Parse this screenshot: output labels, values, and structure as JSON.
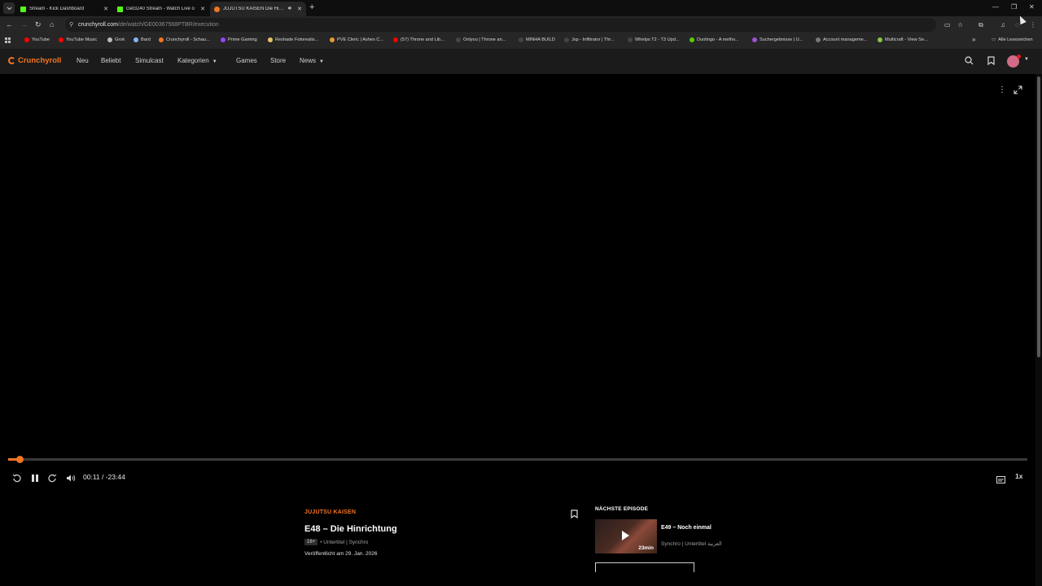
{
  "browser": {
    "tabs": [
      {
        "title": "Stream - Kick Dashboard",
        "favicon_color": "#53fc18",
        "active": false
      },
      {
        "title": "Get3240 Stream - Watch Live o",
        "favicon_color": "#53fc18",
        "active": false
      },
      {
        "title": "JUJUTSU KAISEN Die Hinrich",
        "favicon_color": "#f47521",
        "active": true
      }
    ],
    "url_host": "crunchyroll.com",
    "url_path": "/de/watch/GE00367568PTBR/execution",
    "bookmarks": [
      {
        "label": "YouTube",
        "color": "#ff0000"
      },
      {
        "label": "YouTube Music",
        "color": "#ff0000"
      },
      {
        "label": "Grok",
        "color": "#bbbbbb"
      },
      {
        "label": "Bard",
        "color": "#8ab4f8"
      },
      {
        "label": "Crunchyroll - Schau...",
        "color": "#f47521"
      },
      {
        "label": "Prime Gaming",
        "color": "#9146ff"
      },
      {
        "label": "Reshade Fotorealis...",
        "color": "#e8c26a"
      },
      {
        "label": "PVE Cleric | Ashes C...",
        "color": "#e89a3a"
      },
      {
        "label": "(57) Throne and Lib...",
        "color": "#ff0000"
      },
      {
        "label": "Onlyou | Throne an...",
        "color": "#444444"
      },
      {
        "label": "MINHA BUILD",
        "color": "#444444"
      },
      {
        "label": "Jsp - Infiltrator | Thr...",
        "color": "#444444"
      },
      {
        "label": "Whelps T2 - T3 Upd...",
        "color": "#444444"
      },
      {
        "label": "Duolingo - A melho...",
        "color": "#58cc02"
      },
      {
        "label": "Suchergebnisse | U...",
        "color": "#a34fd6"
      },
      {
        "label": "Account manageme...",
        "color": "#777777"
      },
      {
        "label": "Multicraft - View Se...",
        "color": "#8bc34a"
      }
    ],
    "all_bookmarks_label": "Alle Lesezeichen"
  },
  "site": {
    "logo_text": "Crunchyroll",
    "accent": "#f47521",
    "nav": [
      "Neu",
      "Beliebt",
      "Simulcast",
      "Kategorien",
      "Games",
      "Store",
      "News"
    ]
  },
  "player": {
    "time_text": "00:11 / -23:44",
    "progress_fraction": 0.008,
    "speed_label": "1x"
  },
  "episode": {
    "series": "JUJUTSU KAISEN",
    "title": "E48 – Die Hinrichtung",
    "rating": "16+",
    "meta": "• Untertitel | Synchro",
    "released": "Veröffentlicht am 29. Jan. 2026"
  },
  "next_episode": {
    "label": "NÄCHSTE EPISODE",
    "title": "E49 – Noch einmal",
    "duration": "23min",
    "meta": "Synchro | Untertitel العربية"
  }
}
